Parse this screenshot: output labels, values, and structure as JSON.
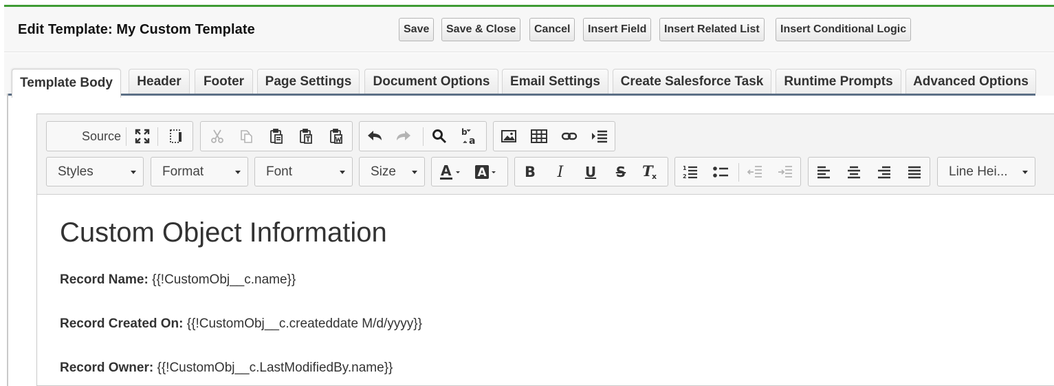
{
  "header": {
    "title": "Edit Template: My Custom Template",
    "buttons": {
      "save": "Save",
      "save_close": "Save & Close",
      "cancel": "Cancel",
      "insert_field": "Insert Field",
      "insert_related_list": "Insert Related List",
      "insert_conditional_logic": "Insert Conditional Logic"
    }
  },
  "tabs": [
    {
      "label": "Template Body",
      "active": true
    },
    {
      "label": "Header"
    },
    {
      "label": "Footer"
    },
    {
      "label": "Page Settings"
    },
    {
      "label": "Document Options"
    },
    {
      "label": "Email Settings"
    },
    {
      "label": "Create Salesforce Task"
    },
    {
      "label": "Runtime Prompts"
    },
    {
      "label": "Advanced Options"
    }
  ],
  "toolbar": {
    "source_label": "Source",
    "styles": "Styles",
    "format": "Format",
    "font": "Font",
    "size": "Size",
    "line_height": "Line Hei...",
    "icons": [
      "maximize-icon",
      "show-blocks-icon",
      "cut-icon",
      "copy-icon",
      "paste-icon",
      "paste-text-icon",
      "paste-word-icon",
      "undo-icon",
      "redo-icon",
      "find-icon",
      "replace-icon",
      "image-icon",
      "table-icon",
      "link-icon",
      "indent-list-icon",
      "text-color-icon",
      "background-color-icon",
      "bold-icon",
      "italic-icon",
      "underline-icon",
      "strikethrough-icon",
      "remove-format-icon",
      "numbered-list-icon",
      "bulleted-list-icon",
      "decrease-indent-icon",
      "increase-indent-icon",
      "align-left-icon",
      "align-center-icon",
      "align-right-icon",
      "justify-icon"
    ]
  },
  "document": {
    "heading": "Custom Object Information",
    "fields": [
      {
        "label": "Record Name:",
        "value": " {{!CustomObj__c.name}}"
      },
      {
        "label": "Record Created On:",
        "value": " {{!CustomObj__c.createddate M/d/yyyy}}"
      },
      {
        "label": "Record Owner:",
        "value": " {{!CustomObj__c.LastModifiedBy.name}}"
      }
    ]
  },
  "colors": {
    "accent_green": "#3f9c35",
    "tab_rule": "#5c6f86"
  }
}
